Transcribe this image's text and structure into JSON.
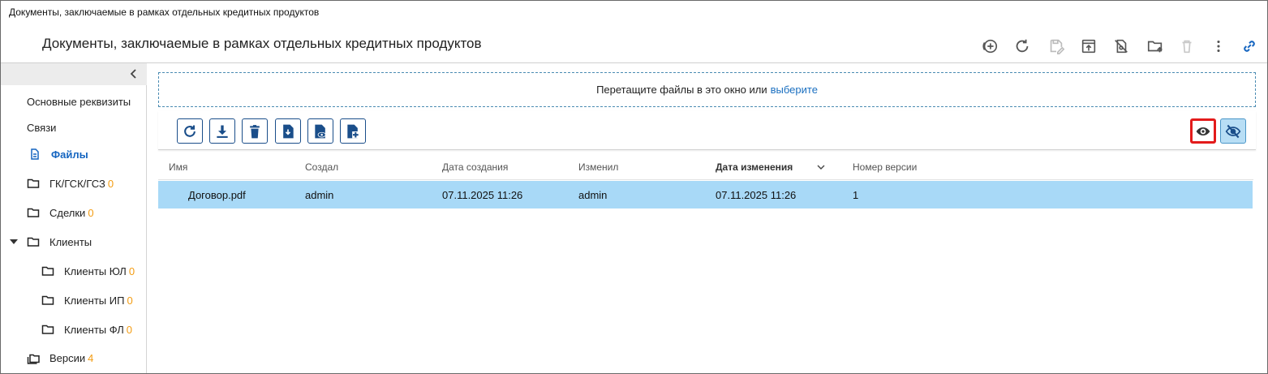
{
  "window": {
    "title": "Документы, заключаемые в рамках отдельных кредитных продуктов"
  },
  "header": {
    "title": "Документы, заключаемые в рамках отдельных кредитных продуктов",
    "actions": [
      {
        "icon": "add-circle-icon"
      },
      {
        "icon": "refresh-icon"
      },
      {
        "icon": "save-edit-icon"
      },
      {
        "icon": "open-in-icon"
      },
      {
        "icon": "lock-off-icon"
      },
      {
        "icon": "folder-upload-icon"
      },
      {
        "icon": "trash-icon"
      },
      {
        "icon": "more-vertical-icon"
      },
      {
        "icon": "link-icon"
      }
    ]
  },
  "sidebar": {
    "items": [
      {
        "label": "Основные реквизиты"
      },
      {
        "label": "Связи"
      },
      {
        "label": "Файлы",
        "active": true,
        "icon": "document-icon"
      },
      {
        "label": "ГК/ГСК/ГСЗ",
        "count": "0",
        "icon": "folder-icon"
      },
      {
        "label": "Сделки",
        "count": "0",
        "icon": "folder-icon"
      },
      {
        "label": "Клиенты",
        "icon": "folder-icon",
        "expanded": true
      },
      {
        "label": "Клиенты ЮЛ",
        "count": "0",
        "icon": "folder-icon"
      },
      {
        "label": "Клиенты ИП",
        "count": "0",
        "icon": "folder-icon"
      },
      {
        "label": "Клиенты ФЛ",
        "count": "0",
        "icon": "folder-icon"
      },
      {
        "label": "Версии",
        "count": "4",
        "icon": "versions-icon"
      }
    ]
  },
  "dropzone": {
    "text": "Перетащите файлы в это окно или",
    "link": "выберите"
  },
  "toolbar": {
    "buttons": [
      {
        "icon": "refresh-icon"
      },
      {
        "icon": "download-icon"
      },
      {
        "icon": "delete-icon"
      },
      {
        "icon": "file-import-icon"
      },
      {
        "icon": "file-preview-icon"
      },
      {
        "icon": "file-add-icon"
      }
    ],
    "view_buttons": [
      {
        "icon": "eye-icon",
        "state": "highlighted"
      },
      {
        "icon": "eye-off-icon",
        "state": "active"
      }
    ]
  },
  "table": {
    "columns": [
      "Имя",
      "Создал",
      "Дата создания",
      "Изменил",
      "Дата изменения",
      "Номер версии"
    ],
    "sorted_column": "Дата изменения",
    "rows": [
      [
        "Договор.pdf",
        "admin",
        "07.11.2025 11:26",
        "admin",
        "07.11.2025 11:26",
        "1"
      ]
    ]
  },
  "colors": {
    "accent": "#1565c0",
    "count": "#f39c12",
    "selected_row": "#a8d9f7",
    "highlight_border": "#e31b1b",
    "button_border": "#1a4e8a"
  }
}
